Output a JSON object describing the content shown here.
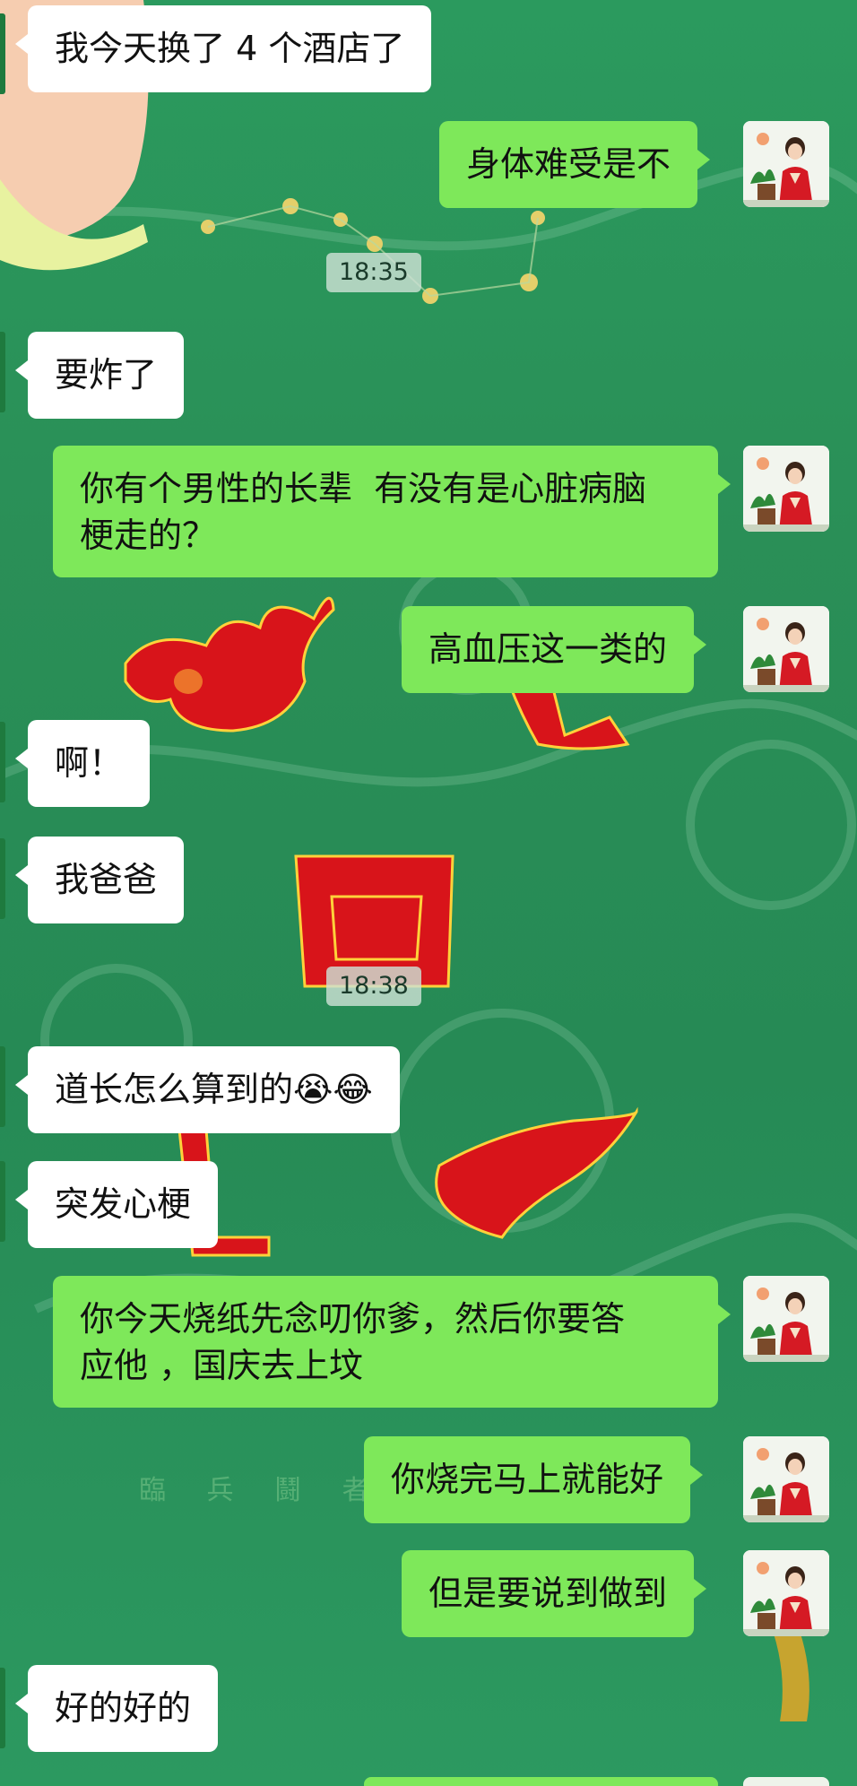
{
  "messages": [
    {
      "side": "left",
      "text": "我今天换了 4 个酒店了"
    },
    {
      "side": "right",
      "text": "身体难受是不"
    },
    {
      "side": "left",
      "text": "要炸了"
    },
    {
      "side": "right",
      "text": "你有个男性的长辈  有没有是心脏病脑\n梗走的？"
    },
    {
      "side": "right",
      "text": "高血压这一类的"
    },
    {
      "side": "left",
      "text": "啊！"
    },
    {
      "side": "left",
      "text": "我爸爸"
    },
    {
      "side": "left",
      "text": "道长怎么算到的😭😂"
    },
    {
      "side": "left",
      "text": "突发心梗"
    },
    {
      "side": "right",
      "text": "你今天烧纸先念叨你爹，然后你要答\n应他 ，国庆去上坟"
    },
    {
      "side": "right",
      "text": "你烧完马上就能好"
    },
    {
      "side": "right",
      "text": "但是要说到做到"
    },
    {
      "side": "left",
      "text": "好的好的"
    }
  ],
  "timestamps": [
    "18:35",
    "18:38"
  ],
  "wallpaper_text": "臨 兵 鬪 者",
  "colors": {
    "outgoing": "#7ee85a",
    "incoming": "#ffffff",
    "background": "#2a8f57"
  },
  "icons": {
    "avatar": "avatar-lady-in-red-icon"
  }
}
